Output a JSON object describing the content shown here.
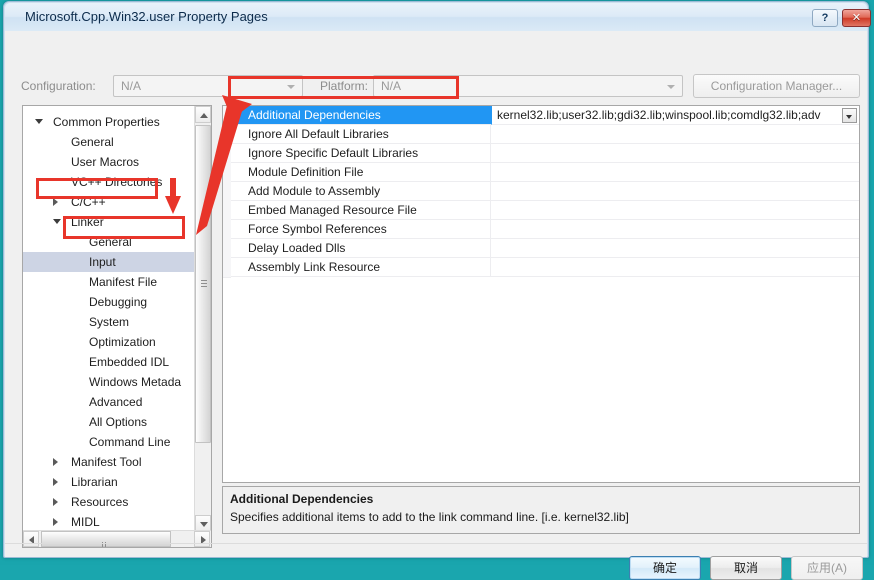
{
  "window": {
    "title": "Microsoft.Cpp.Win32.user Property Pages",
    "help_button": "?",
    "close_button": "✕"
  },
  "toolbar": {
    "configuration_label": "Configuration:",
    "configuration_value": "N/A",
    "platform_label": "Platform:",
    "platform_value": "N/A",
    "configuration_manager_label": "Configuration Manager..."
  },
  "tree": {
    "nodes": [
      {
        "label": "Common Properties",
        "indent": 0,
        "marker": "open",
        "selected": false
      },
      {
        "label": "General",
        "indent": 1,
        "marker": "none",
        "selected": false
      },
      {
        "label": "User Macros",
        "indent": 1,
        "marker": "none",
        "selected": false
      },
      {
        "label": "VC++ Directories",
        "indent": 1,
        "marker": "none",
        "selected": false
      },
      {
        "label": "C/C++",
        "indent": 1,
        "marker": "closed",
        "selected": false
      },
      {
        "label": "Linker",
        "indent": 1,
        "marker": "open",
        "selected": false
      },
      {
        "label": "General",
        "indent": 2,
        "marker": "none",
        "selected": false
      },
      {
        "label": "Input",
        "indent": 2,
        "marker": "none",
        "selected": true
      },
      {
        "label": "Manifest File",
        "indent": 2,
        "marker": "none",
        "selected": false
      },
      {
        "label": "Debugging",
        "indent": 2,
        "marker": "none",
        "selected": false
      },
      {
        "label": "System",
        "indent": 2,
        "marker": "none",
        "selected": false
      },
      {
        "label": "Optimization",
        "indent": 2,
        "marker": "none",
        "selected": false
      },
      {
        "label": "Embedded IDL",
        "indent": 2,
        "marker": "none",
        "selected": false
      },
      {
        "label": "Windows Metada",
        "indent": 2,
        "marker": "none",
        "selected": false
      },
      {
        "label": "Advanced",
        "indent": 2,
        "marker": "none",
        "selected": false
      },
      {
        "label": "All Options",
        "indent": 2,
        "marker": "none",
        "selected": false
      },
      {
        "label": "Command Line",
        "indent": 2,
        "marker": "none",
        "selected": false
      },
      {
        "label": "Manifest Tool",
        "indent": 1,
        "marker": "closed",
        "selected": false
      },
      {
        "label": "Librarian",
        "indent": 1,
        "marker": "closed",
        "selected": false
      },
      {
        "label": "Resources",
        "indent": 1,
        "marker": "closed",
        "selected": false
      },
      {
        "label": "MIDL",
        "indent": 1,
        "marker": "closed",
        "selected": false
      }
    ]
  },
  "grid": {
    "rows": [
      {
        "name": "Additional Dependencies",
        "value": "kernel32.lib;user32.lib;gdi32.lib;winspool.lib;comdlg32.lib;adv",
        "selected": true,
        "has_dropdown": true
      },
      {
        "name": "Ignore All Default Libraries",
        "value": "",
        "selected": false,
        "has_dropdown": false
      },
      {
        "name": "Ignore Specific Default Libraries",
        "value": "",
        "selected": false,
        "has_dropdown": false
      },
      {
        "name": "Module Definition File",
        "value": "",
        "selected": false,
        "has_dropdown": false
      },
      {
        "name": "Add Module to Assembly",
        "value": "",
        "selected": false,
        "has_dropdown": false
      },
      {
        "name": "Embed Managed Resource File",
        "value": "",
        "selected": false,
        "has_dropdown": false
      },
      {
        "name": "Force Symbol References",
        "value": "",
        "selected": false,
        "has_dropdown": false
      },
      {
        "name": "Delay Loaded Dlls",
        "value": "",
        "selected": false,
        "has_dropdown": false
      },
      {
        "name": "Assembly Link Resource",
        "value": "",
        "selected": false,
        "has_dropdown": false
      }
    ]
  },
  "description": {
    "title": "Additional Dependencies",
    "text": "Specifies additional items to add to the link command line. [i.e. kernel32.lib]"
  },
  "footer": {
    "ok_label": "确定",
    "cancel_label": "取消",
    "apply_label": "应用(A)"
  },
  "annotations": {
    "accent_color": "#e8352a",
    "boxes": [
      "linker-node",
      "input-node",
      "additional-dependencies-row"
    ],
    "arrows": [
      "down-arrow-to-input",
      "long-arrow-to-additional-dependencies"
    ]
  }
}
